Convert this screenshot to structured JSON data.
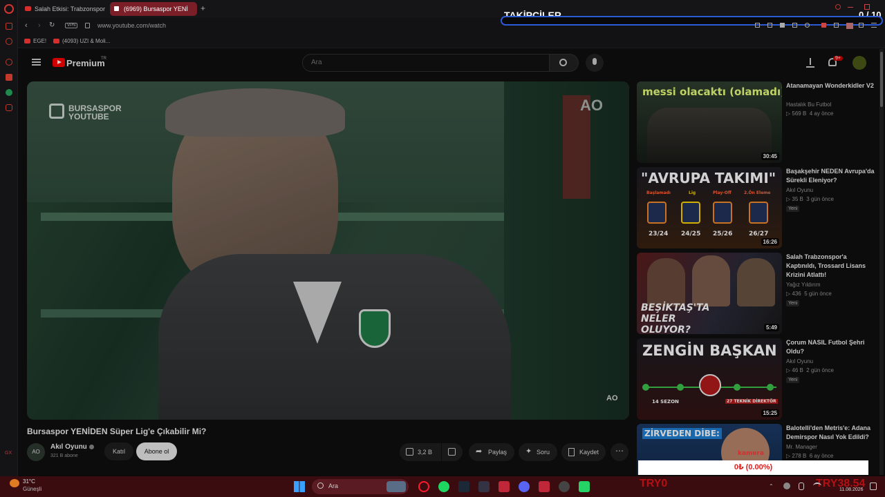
{
  "overlay": {
    "title": "TAKİPÇİLER",
    "counter": "0 / 10",
    "bottom_amount": "0₺ (0.00%)"
  },
  "tabs": [
    {
      "label": "Salah Etkisi: Trabzonspor 6"
    },
    {
      "label": "(6969) Bursaspor YENİ"
    }
  ],
  "address": {
    "url": "www.youtube.com/watch",
    "vpn": "VPN"
  },
  "bookmarks": [
    {
      "label": "EGE!"
    },
    {
      "label": "(4093) UZI & Moli..."
    }
  ],
  "youtube": {
    "logo": "Premium",
    "logo_sup": "TR",
    "search_placeholder": "Ara",
    "notif_count": "9+",
    "video": {
      "watermark_top": "BURSASPOR",
      "watermark_bottom": "YOUTUBE",
      "corner_logo": "AO",
      "title": "Bursaspor YENİDEN Süper Lig'e Çıkabilir Mi?",
      "channel": "Akıl Oyunu",
      "subs": "321 B abone",
      "join": "Katıl",
      "subscribe": "Abone ol",
      "likes": "3,2 B",
      "share": "Paylaş",
      "ask": "Soru",
      "save": "Kaydet"
    },
    "recommendations": [
      {
        "title": "Atanamayan Wonderkidler V2",
        "channel": "Hastalık Bu Futbol",
        "views": "569 B",
        "age": "4 ay önce",
        "duration": "30:45",
        "thumb_text": "messi olacaktı (olamadı)",
        "new": ""
      },
      {
        "title": "Başakşehir NEDEN Avrupa'da Sürekli Eleniyor?",
        "channel": "Akıl Oyunu",
        "views": "35 B",
        "age": "3 gün önce",
        "duration": "16:26",
        "thumb_text": "\"AVRUPA TAKIMI\"",
        "years": [
          "23/24",
          "24/25",
          "25/26",
          "26/27"
        ],
        "stages": [
          "Başlamadı",
          "Lig",
          "Play-Off",
          "2.Ön Eleme"
        ],
        "new": "Yeni"
      },
      {
        "title": "Salah Trabzonspor'a Kaptınıldı, Trossard Lisans Krizini Atlattı!",
        "channel": "Yağız Yıldırım",
        "views": "436",
        "age": "5 gün önce",
        "duration": "5:49",
        "thumb_text": "BEŞİKTAŞ'TA NELER OLUYOR?",
        "new": "Yeni"
      },
      {
        "title": "Çorum NASIL Futbol Şehri Oldu?",
        "channel": "Akıl Oyunu",
        "views": "46 B",
        "age": "2 gün önce",
        "duration": "15:25",
        "thumb_text": "ZENGİN BAŞKAN",
        "thumb_sub1": "14 SEZON",
        "thumb_sub2": "27 TEKNİK DİREKTÖR",
        "new": "Yeni"
      },
      {
        "title": "Balotelli'den Metris'e: Adana Demirspor Nasıl Yok Edildi?",
        "channel": "Mr. Manager",
        "views": "278 B",
        "age": "6 ay önce",
        "duration": "",
        "thumb_text": "ZİRVEDEN DİBE:",
        "thumb_sub1": "kamera",
        "new": ""
      }
    ]
  },
  "taskbar": {
    "weather_temp": "31°C",
    "weather_desc": "Güneşli",
    "search": "Ara",
    "left_tag": "TRY0",
    "right_tag": "TRY38.54",
    "date": "11.08.2026"
  },
  "colors": {
    "yt_red": "#ff0000",
    "accent_blue": "#2d5bd6",
    "taskbar": "#3a0c10"
  }
}
